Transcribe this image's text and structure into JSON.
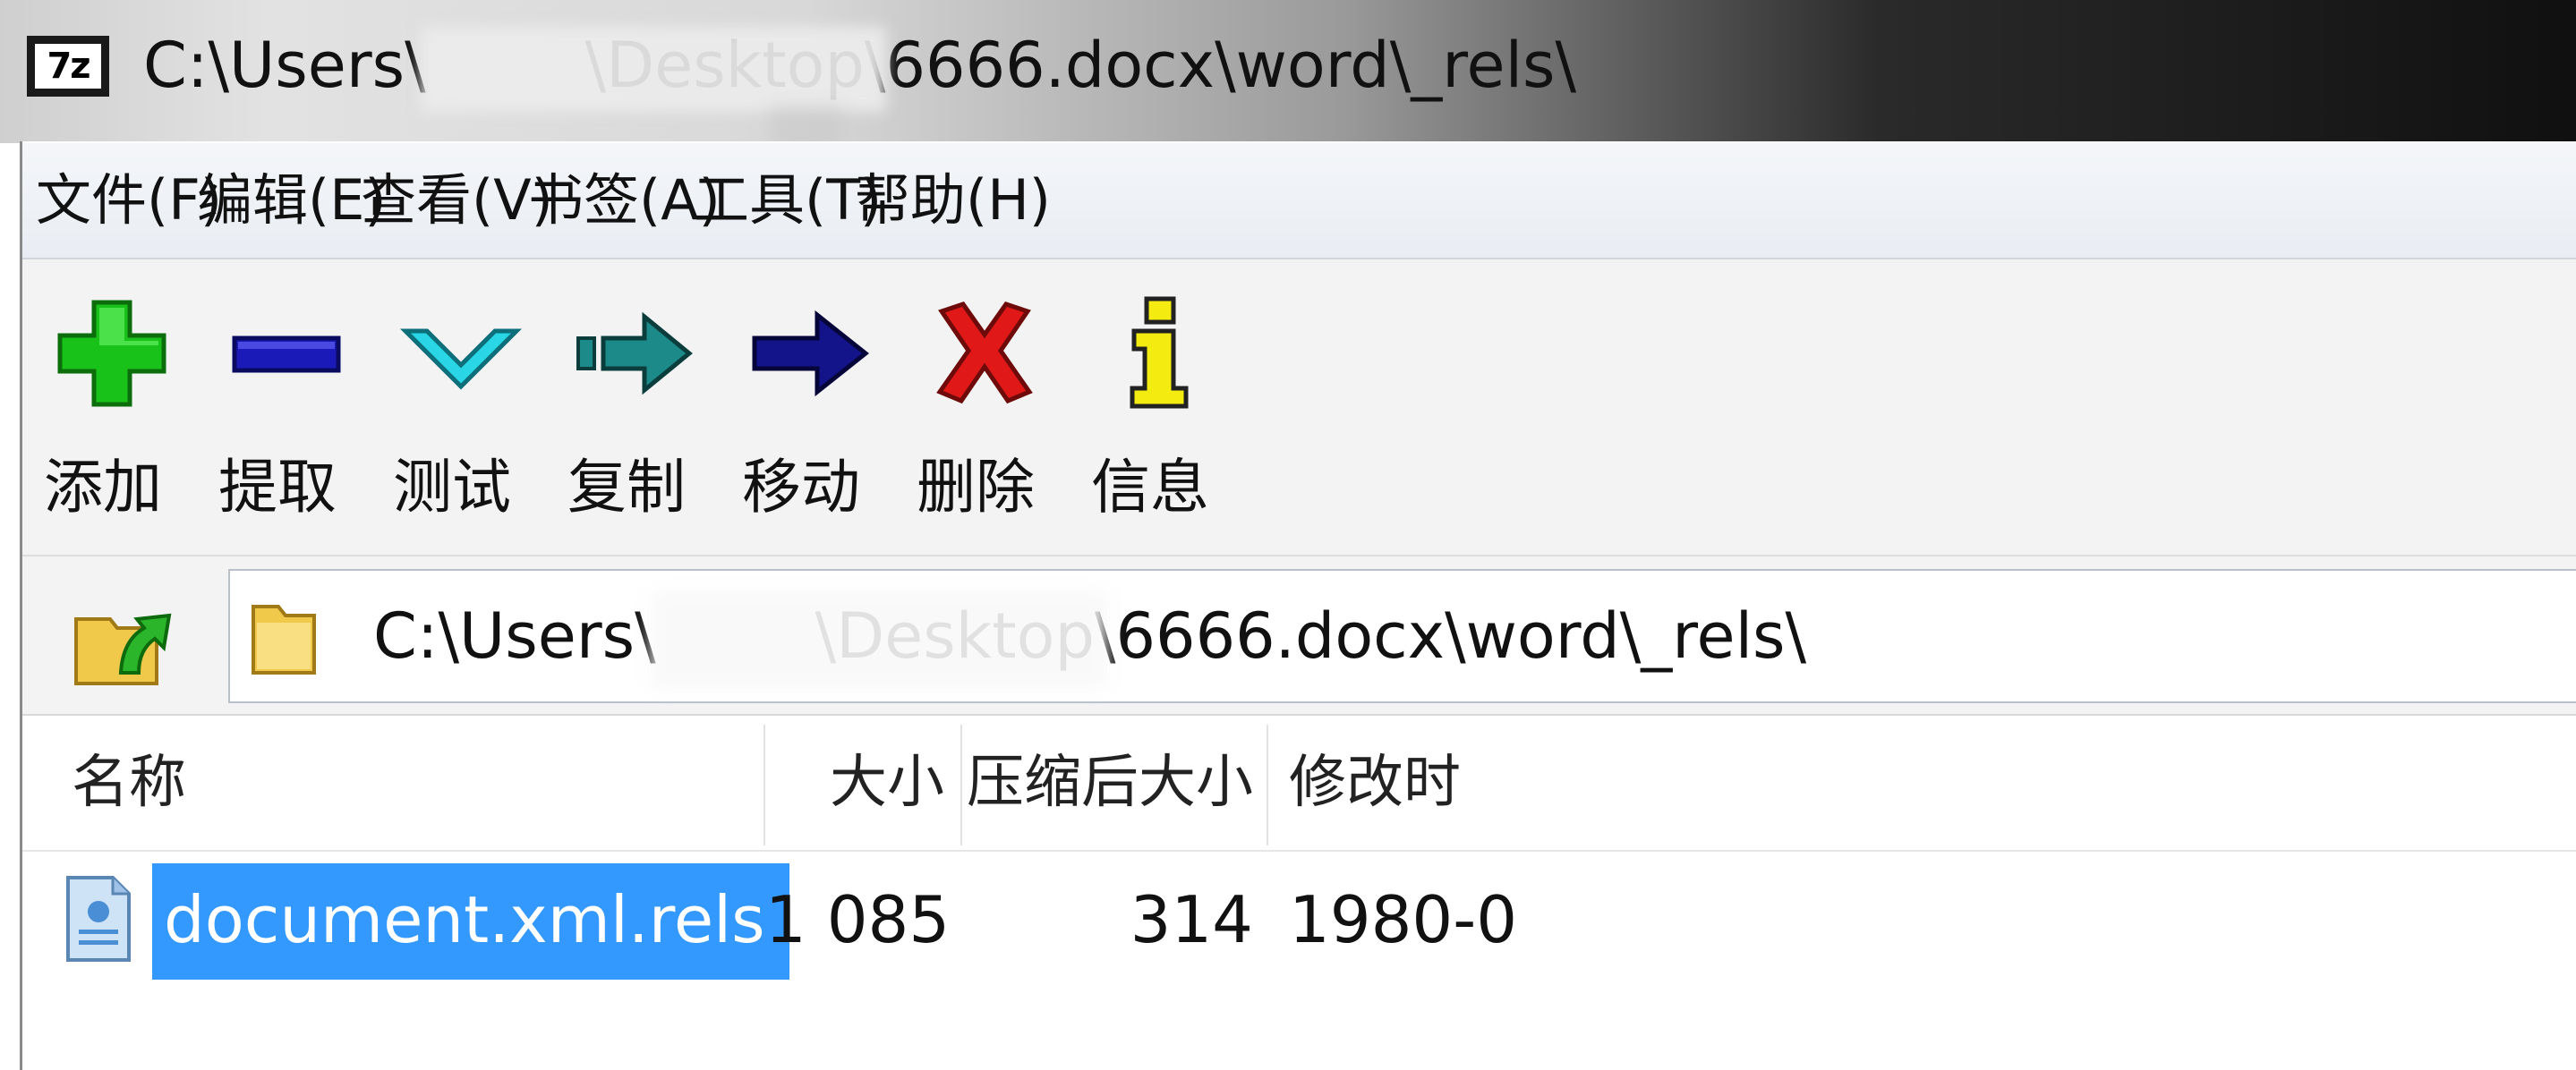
{
  "window": {
    "app_icon_text": "7z",
    "title": "C:\\Users\\        \\Desktop\\6666.docx\\word\\_rels\\"
  },
  "menu": [
    {
      "label": "文件(F)"
    },
    {
      "label": "编辑(E)"
    },
    {
      "label": "查看(V)"
    },
    {
      "label": "书签(A)"
    },
    {
      "label": "工具(T)"
    },
    {
      "label": "帮助(H)"
    }
  ],
  "toolbar": [
    {
      "label": "添加",
      "icon": "plus-icon",
      "color": "#19c219"
    },
    {
      "label": "提取",
      "icon": "minus-icon",
      "color": "#1a1ab8"
    },
    {
      "label": "测试",
      "icon": "check-chevron-icon",
      "color": "#28d6e6"
    },
    {
      "label": "复制",
      "icon": "copy-arrow-icon",
      "color": "#1d8a8a"
    },
    {
      "label": "移动",
      "icon": "move-arrow-icon",
      "color": "#14148a"
    },
    {
      "label": "删除",
      "icon": "delete-x-icon",
      "color": "#e01818"
    },
    {
      "label": "信息",
      "icon": "info-icon",
      "color": "#f4ec10"
    }
  ],
  "address": {
    "path": "C:\\Users\\        \\Desktop\\6666.docx\\word\\_rels\\"
  },
  "list": {
    "columns": [
      "名称",
      "大小",
      "压缩后大小",
      "修改时"
    ],
    "rows": [
      {
        "name": "document.xml.rels",
        "size": "1 085",
        "packed_size": "314",
        "modified": "1980-0",
        "selected": true
      }
    ]
  },
  "colors": {
    "selection": "#3399ff"
  }
}
